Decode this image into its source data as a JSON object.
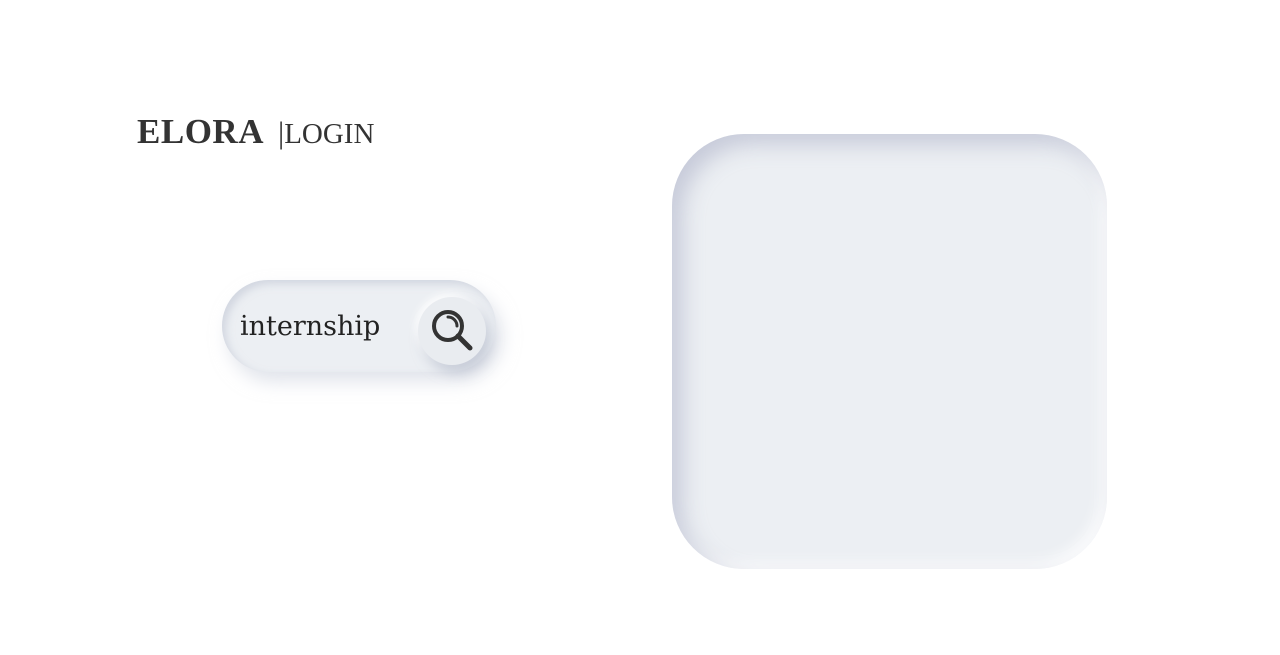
{
  "header": {
    "brand_name": "ELORA",
    "separator": "|",
    "login_label": "LOGIN"
  },
  "search": {
    "value": "internship",
    "button_icon": "search-icon"
  },
  "colors": {
    "background": "#ffffff",
    "surface": "#eceff3",
    "text": "#333333"
  }
}
